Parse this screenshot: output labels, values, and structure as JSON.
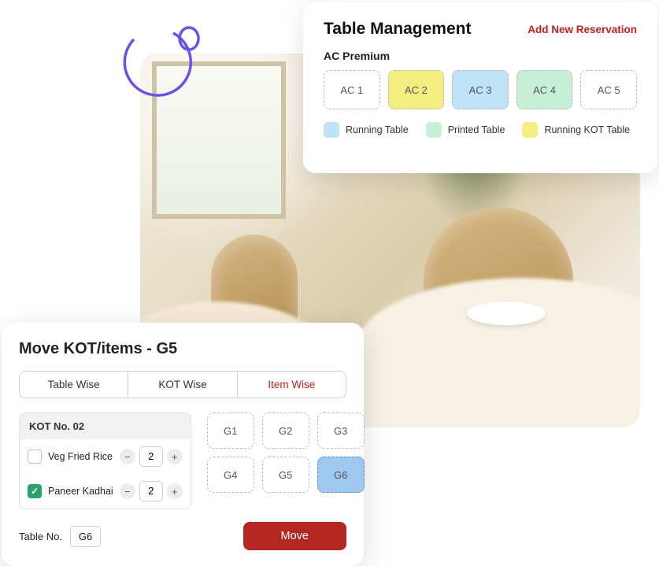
{
  "tableManagement": {
    "title": "Table Management",
    "addNewLabel": "Add New Reservation",
    "sectionLabel": "AC Premium",
    "tables": [
      {
        "label": "AC 1",
        "status": "none"
      },
      {
        "label": "AC 2",
        "status": "kot"
      },
      {
        "label": "AC 3",
        "status": "running"
      },
      {
        "label": "AC 4",
        "status": "printed"
      },
      {
        "label": "AC 5",
        "status": "none"
      }
    ],
    "legend": {
      "running": "Running Table",
      "printed": "Printed Table",
      "kot": "Running KOT Table"
    }
  },
  "moveKot": {
    "title": "Move  KOT/items - G5",
    "tabs": [
      {
        "label": "Table Wise",
        "active": false
      },
      {
        "label": "KOT Wise",
        "active": false
      },
      {
        "label": "Item Wise",
        "active": true
      }
    ],
    "kotHeader": "KOT No. 02",
    "items": [
      {
        "name": "Veg Fried Rice",
        "qty": "2",
        "checked": false
      },
      {
        "name": "Paneer Kadhai",
        "qty": "2",
        "checked": true
      }
    ],
    "targets": [
      {
        "label": "G1",
        "selected": false
      },
      {
        "label": "G2",
        "selected": false
      },
      {
        "label": "G3",
        "selected": false
      },
      {
        "label": "G4",
        "selected": false
      },
      {
        "label": "G5",
        "selected": false
      },
      {
        "label": "G6",
        "selected": true
      }
    ],
    "tableNoLabel": "Table No.",
    "tableNoValue": "G6",
    "moveButton": "Move"
  },
  "colors": {
    "accent": "#c31f1f",
    "moveBtn": "#b52620",
    "running": "#bfe2f6",
    "printed": "#c7eed6",
    "kot": "#f4ee81",
    "selectedTarget": "#9ec8f0",
    "checked": "#29a36a"
  }
}
